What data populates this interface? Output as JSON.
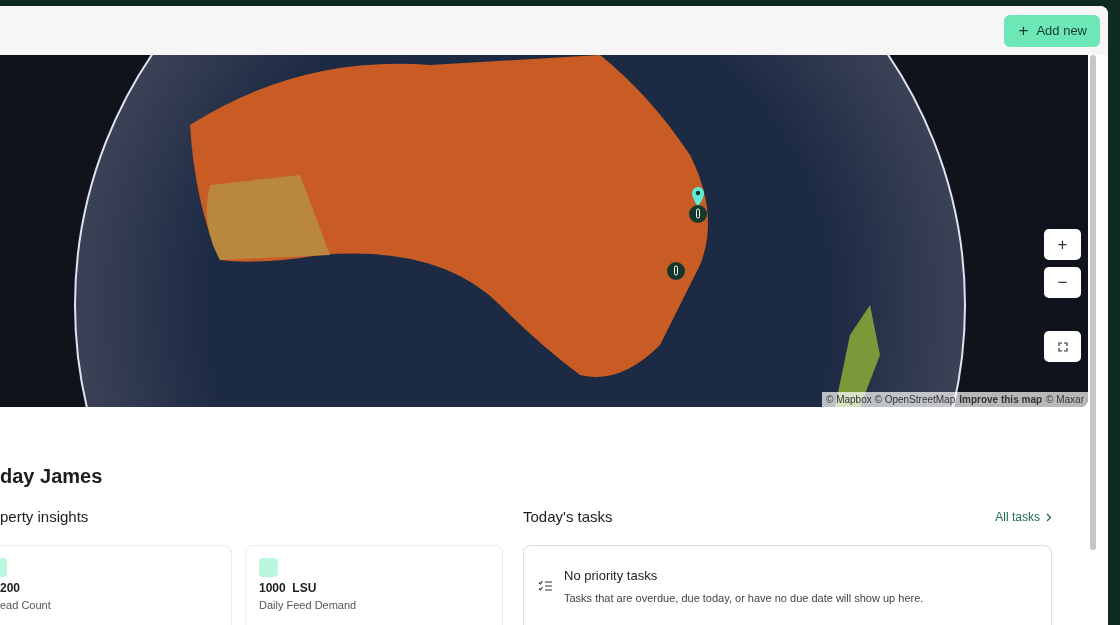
{
  "top_bar": {
    "add_button": {
      "icon": "+",
      "label": "Add new"
    }
  },
  "map": {
    "controls": [
      {
        "kind": "zoom-in",
        "label": "+"
      },
      {
        "kind": "zoom-out",
        "label": "−"
      },
      {
        "kind": "fullscreen"
      }
    ],
    "attribution": {
      "text": "© Mapbox © OpenStreetMap",
      "link": "Improve this map",
      "suffix": "© Maxar"
    }
  },
  "greeting": "day James",
  "insights": {
    "title": "perty insights",
    "cards": [
      {
        "value": "200",
        "label": "ead Count"
      },
      {
        "value": "1000  LSU",
        "label": "Daily Feed Demand"
      }
    ]
  },
  "tasks": {
    "title": "Today's tasks",
    "link": "All tasks",
    "empty_title": "No priority tasks",
    "empty_text": "Tasks that are overdue, due today, or have no due date will show up here."
  }
}
